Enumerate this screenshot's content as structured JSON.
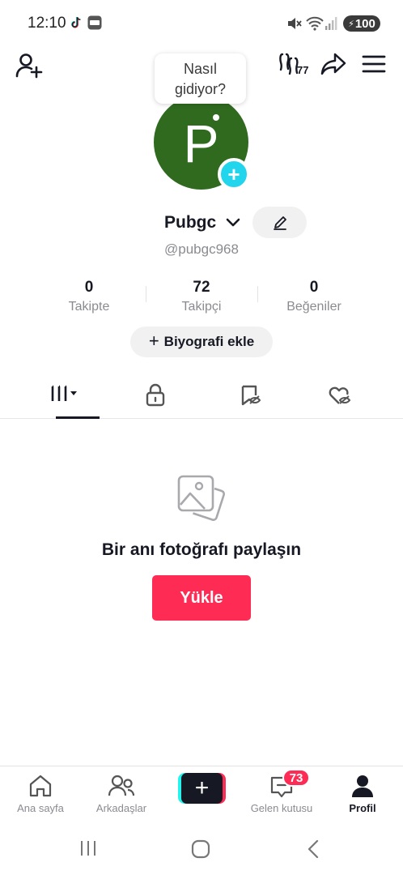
{
  "status_bar": {
    "time": "12:10",
    "battery": "100",
    "icons": [
      "tiktok-icon",
      "app-icon",
      "mute-icon",
      "wifi-icon",
      "signal-icon",
      "battery-icon"
    ]
  },
  "header": {
    "add_friend_icon": "person-plus-icon",
    "friends_count": "77",
    "share_icon": "share-arrow-icon",
    "menu_icon": "hamburger-menu-icon"
  },
  "profile": {
    "tooltip": "Nasıl\ngidiyor?",
    "tooltip_line1": "Nasıl",
    "tooltip_line2": "gidiyor?",
    "avatar_letter": "P",
    "avatar_color": "#2f6a1f",
    "add_badge": "+",
    "name": "Pubgc",
    "handle": "@pubgc968"
  },
  "stats": [
    {
      "value": "0",
      "label": "Takipte"
    },
    {
      "value": "72",
      "label": "Takipçi"
    },
    {
      "value": "0",
      "label": "Beğeniler"
    }
  ],
  "bio_button": {
    "plus": "+",
    "label": "Biyografi ekle"
  },
  "tabs": [
    {
      "icon": "grid-videos-icon",
      "active": true
    },
    {
      "icon": "lock-icon",
      "active": false
    },
    {
      "icon": "favorites-hidden-icon",
      "active": false
    },
    {
      "icon": "liked-hidden-icon",
      "active": false
    }
  ],
  "empty_state": {
    "icon": "photos-icon",
    "text": "Bir anı fotoğrafı paylaşın",
    "button": "Yükle"
  },
  "bottom_nav": [
    {
      "label": "Ana sayfa",
      "icon": "home-icon"
    },
    {
      "label": "Arkadaşlar",
      "icon": "friends-icon"
    },
    {
      "label": "",
      "icon": "create-plus-icon"
    },
    {
      "label": "Gelen kutusu",
      "icon": "inbox-icon"
    },
    {
      "label": "Profil",
      "icon": "profile-icon",
      "active": true
    }
  ],
  "inbox_badge": "73",
  "colors": {
    "accent": "#fe2c55",
    "cyan": "#25f4ee",
    "text": "#161823",
    "muted": "#8a8b91"
  }
}
